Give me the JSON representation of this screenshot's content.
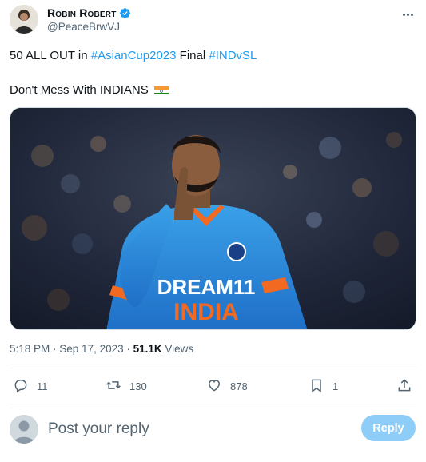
{
  "author": {
    "display_name": "Robin Robert",
    "handle": "@PeaceBrwVJ",
    "verified": true
  },
  "tweet": {
    "line1_prefix": "50 ALL OUT in ",
    "hashtag1": "#AsianCup2023",
    "line1_mid": " Final ",
    "hashtag2": "#INDvSL",
    "line2": "Don't Mess With INDIANS",
    "flag_icon": "india-flag-icon",
    "image_jersey_text_top": "DREAM11",
    "image_jersey_text_bottom": "INDIA"
  },
  "meta": {
    "time": "5:18 PM",
    "date": "Sep 17, 2023",
    "separator": " · ",
    "views_count": "51.1K",
    "views_label": "Views"
  },
  "actions": {
    "replies": "11",
    "retweets": "130",
    "likes": "878",
    "bookmarks": "1"
  },
  "reply_box": {
    "placeholder": "Post your reply",
    "button_label": "Reply"
  },
  "colors": {
    "accent": "#1d9bf0",
    "reply_button": "#8ecdf7",
    "secondary_text": "#536471"
  }
}
